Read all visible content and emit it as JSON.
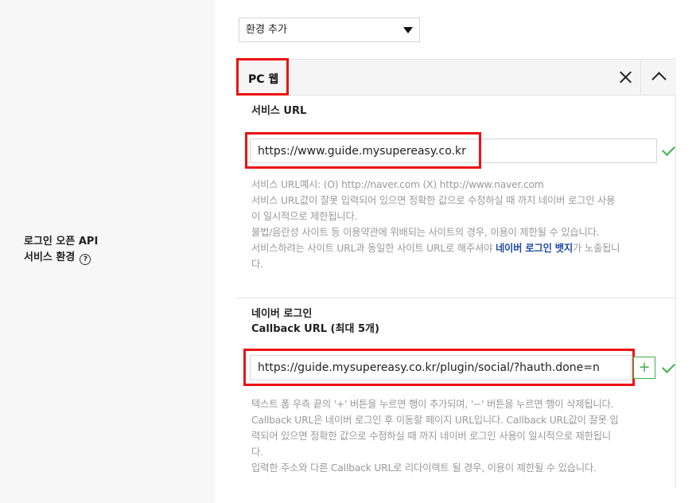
{
  "env_select": {
    "value": "환경 추가"
  },
  "left": {
    "label_line1": "로그인 오픈 API",
    "label_line2": "서비스 환경",
    "help_glyph": "?"
  },
  "panel": {
    "title": "PC 웹",
    "service_url": {
      "label": "서비스 URL",
      "value": "https://www.guide.mysupereasy.co.kr",
      "help_lines": [
        "서비스 URL예시: (O) http://naver.com (X) http://www.naver.com",
        "서비스 URL값이 잘못 입력되어 있으면 정확한 값으로 수정하실 때 까지 네이버 로그인 사용",
        "이 일시적으로 제한됩니다.",
        "불법/음란성 사이트 등 이용약관에 위배되는 사이트의 경우, 이용이 제한될 수 있습니다."
      ],
      "help_line5_pre": "서비스하려는 사이트 URL과 동일한 사이트 URL로 해주셔야 ",
      "help_line5_bold": "네이버 로그인 뱃지",
      "help_line5_post": "가 노출됩니",
      "help_line6": "다."
    },
    "callback": {
      "label_line1": "네이버 로그인",
      "label_line2": "Callback URL (최대 5개)",
      "value": "https://guide.mysupereasy.co.kr/plugin/social/?hauth.done=n",
      "add_label": "+",
      "help_lines": [
        "텍스트 폼 우측 끝의 '+' 버튼을 누르면 행이 추가되며, '−' 버튼을 누르면 행이 삭제됩니다.",
        "Callback URL은 네이버 로그인 후 이동할 페이지 URL입니다. Callback URL값이 잘못 입",
        "력되어 있으면 정확한 값으로 수정하실 때 까지 네이버 로그인 사용이 일시적으로 제한됩니",
        "다.",
        "입력한 주소와 다른 Callback URL로 리다이렉트 될 경우, 이용이 제한될 수 있습니다."
      ]
    }
  },
  "colors": {
    "annotation": "#e11111",
    "valid": "#3bb14a",
    "link": "#1c4aa8"
  }
}
